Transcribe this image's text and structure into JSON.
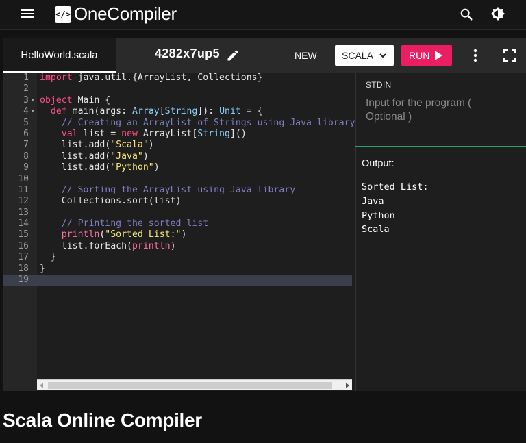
{
  "app": {
    "logo_mark": "</>",
    "name": "OneCompiler"
  },
  "header": {
    "icons": [
      "menu-icon",
      "search-icon",
      "theme-toggle-icon"
    ]
  },
  "editor": {
    "tab_label": "HelloWorld.scala",
    "file_id": "4282x7up5",
    "new_label": "NEW",
    "language_label": "SCALA",
    "run_label": "RUN",
    "line_numbers": [
      "1",
      "2",
      "3",
      "4",
      "5",
      "6",
      "7",
      "8",
      "9",
      "10",
      "11",
      "12",
      "13",
      "14",
      "15",
      "16",
      "17",
      "18",
      "19"
    ]
  },
  "stdin": {
    "label": "STDIN",
    "placeholder": "Input for the program ( Optional )"
  },
  "output": {
    "label": "Output:",
    "text": "Sorted List:\nJava\nPython\nScala"
  },
  "page": {
    "heading": "Scala Online Compiler"
  },
  "colors": {
    "accent_run": "#e91e63",
    "divider": "#2e9e6a",
    "keyword": "#ff4d8a",
    "string": "#f5e37a",
    "comment": "#7e7ec4",
    "type": "#8bd0ff"
  }
}
